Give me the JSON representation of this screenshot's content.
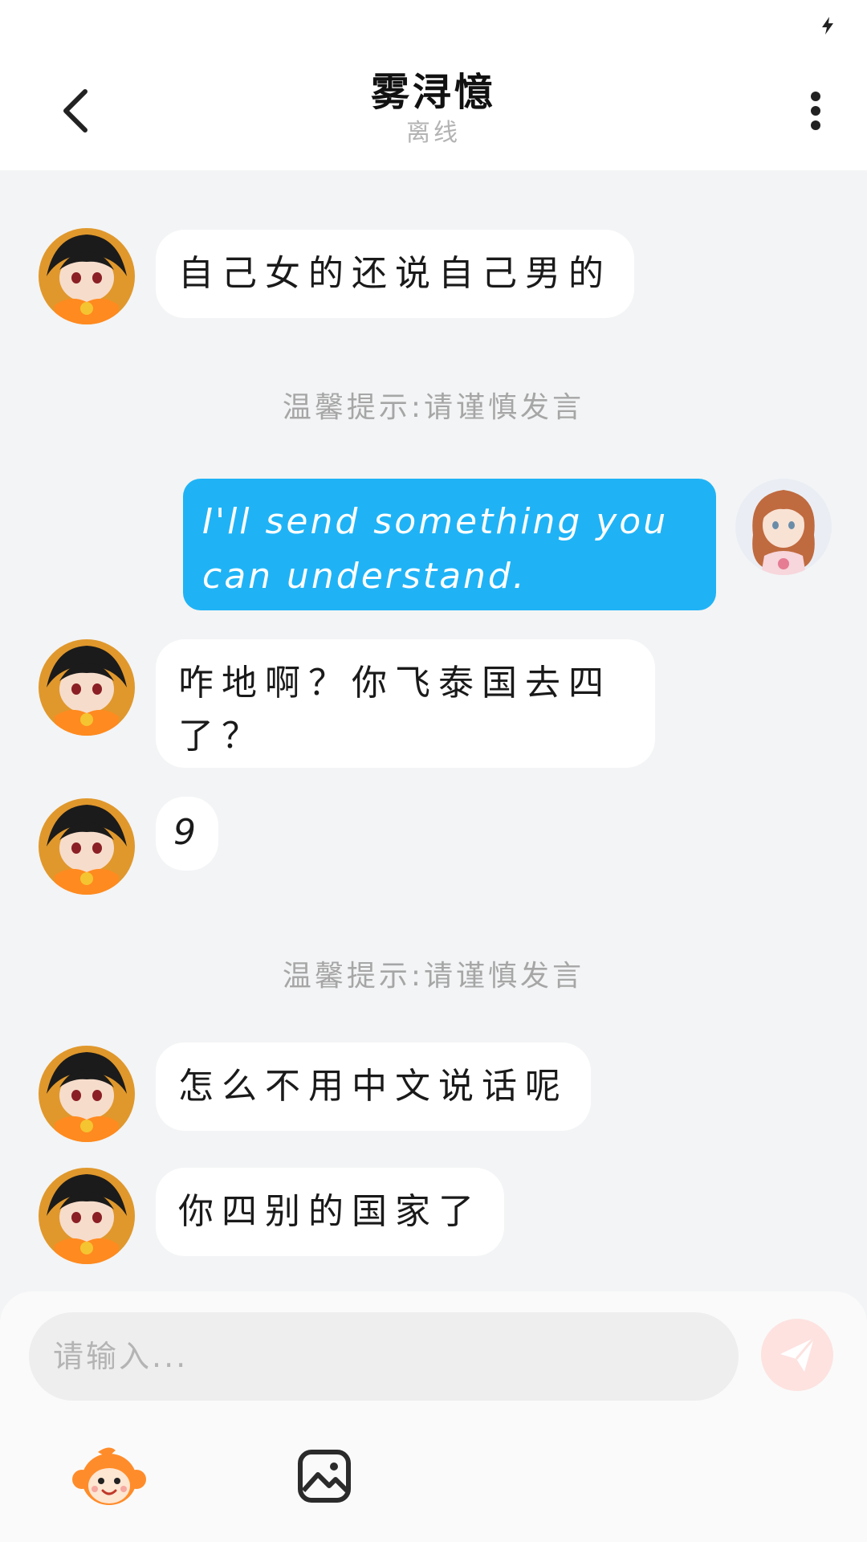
{
  "header": {
    "title": "雾浔憶",
    "status": "离线"
  },
  "notice_text": "温馨提示:请谨慎发言",
  "messages": [
    {
      "side": "left",
      "text": "自己女的还说自己男的"
    },
    {
      "side": "right",
      "text": "I'll send something you can understand."
    },
    {
      "side": "left",
      "text": "咋地啊？你飞泰国去四了？"
    },
    {
      "side": "left",
      "text": "9"
    },
    {
      "side": "left",
      "text": "怎么不用中文说话呢"
    },
    {
      "side": "left",
      "text": "你四别的国家了"
    }
  ],
  "composer": {
    "placeholder": "请输入..."
  },
  "icons": {
    "status_charge": "charging-bolt-icon",
    "back": "chevron-left-icon",
    "more": "more-vertical-icon",
    "send": "paper-plane-icon",
    "sticker": "monkey-sticker-icon",
    "image": "image-icon"
  },
  "colors": {
    "my_bubble": "#1fb3f6",
    "background": "#f3f4f5",
    "send_button": "#fde2e0"
  }
}
